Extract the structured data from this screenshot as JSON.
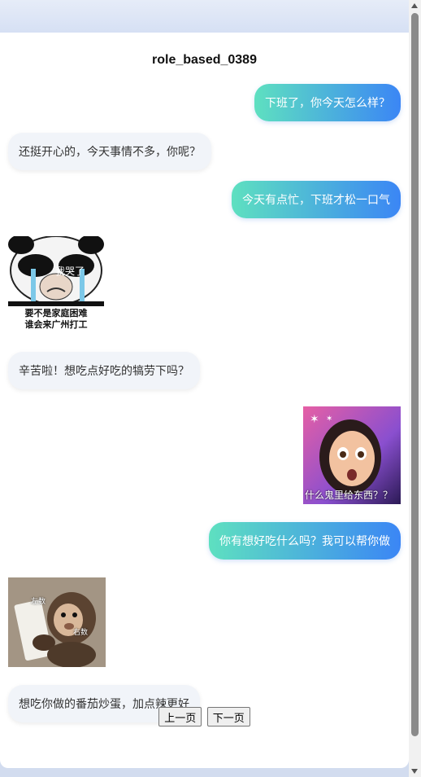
{
  "title": "role_based_0389",
  "messages": [
    {
      "role": "user",
      "text": "下班了，你今天怎么样？"
    },
    {
      "role": "bot",
      "text": "还挺开心的，今天事情不多，你呢？"
    },
    {
      "role": "user",
      "text": "今天有点忙，下班才松一口气"
    },
    {
      "role": "bot",
      "sticker": "crying-panda",
      "caption_top": "我哭了",
      "caption_line1": "要不是家庭困难",
      "caption_line2": "谁会来广州打工"
    },
    {
      "role": "bot",
      "text": "辛苦啦！想吃点好吃的犒劳下吗？"
    },
    {
      "role": "user",
      "sticker": "shocked-cartoon-girl",
      "caption": "什么鬼里给东西？？"
    },
    {
      "role": "user",
      "text": "你有想好吃什么吗？我可以帮你做"
    },
    {
      "role": "bot",
      "sticker": "monkey-reading-list",
      "label_left": "左数",
      "label_right": "右数"
    },
    {
      "role": "bot",
      "text": "想吃你做的番茄炒蛋，加点辣更好"
    }
  ],
  "pager": {
    "prev": "上一页",
    "next": "下一页"
  }
}
